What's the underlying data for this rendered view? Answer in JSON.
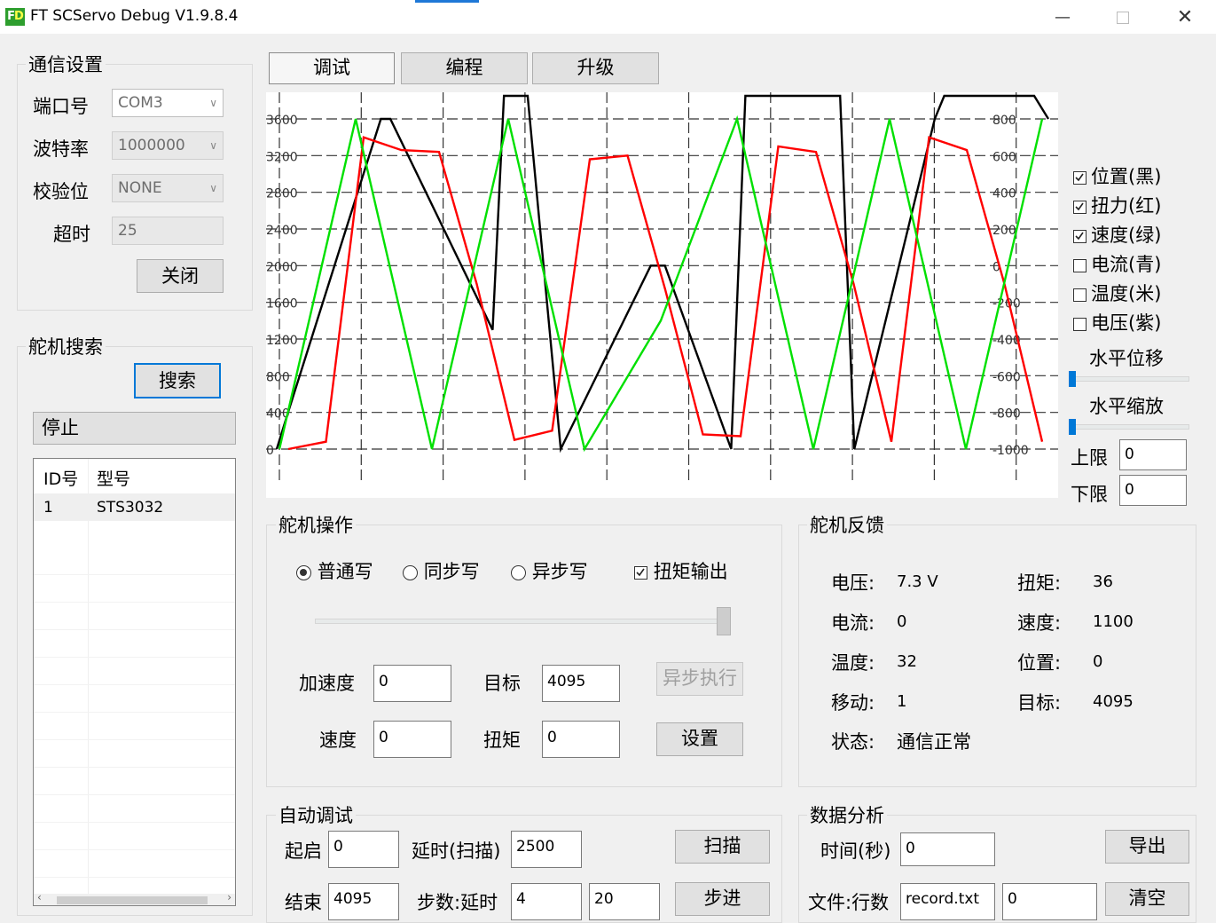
{
  "window": {
    "title": "FT SCServo Debug V1.9.8.4",
    "icon_text": "FD",
    "controls": [
      "minimize-icon",
      "maximize-icon",
      "close-icon"
    ]
  },
  "comm": {
    "group_title": "通信设置",
    "port_label": "端口号",
    "port_value": "COM3",
    "baud_label": "波特率",
    "baud_value": "1000000",
    "parity_label": "校验位",
    "parity_value": "NONE",
    "timeout_label": "超时",
    "timeout_value": "25",
    "close_button": "关闭"
  },
  "search": {
    "group_title": "舵机搜索",
    "search_button": "搜索",
    "stop_button": "停止",
    "columns": [
      "ID号",
      "型号"
    ],
    "rows": [
      {
        "id": "1",
        "model": "STS3032"
      }
    ]
  },
  "tabs": [
    "调试",
    "编程",
    "升级"
  ],
  "chart": {
    "left_ticks": [
      "3600",
      "3200",
      "2800",
      "2400",
      "2000",
      "1600",
      "1200",
      "800",
      "400",
      "0"
    ],
    "right_ticks": [
      "800",
      "600",
      "400",
      "200",
      "0",
      "-200",
      "-400",
      "-600",
      "-800",
      "-1000"
    ],
    "colors": {
      "position": "#000000",
      "torque": "#ff0000",
      "speed": "#00e000"
    }
  },
  "chart_data": {
    "type": "line",
    "left_axis_ylim": [
      0,
      3600
    ],
    "right_axis_ylim": [
      -1000,
      800
    ],
    "grid": true,
    "series": [
      {
        "name": "位置(黑)",
        "axis": "left",
        "x": [
          0,
          12,
          110,
          120,
          228,
          240,
          265,
          300,
          395,
          410,
          480,
          495,
          595,
          610,
          695,
          705,
          800,
          815
        ],
        "values": [
          0,
          400,
          3600,
          3600,
          1300,
          4095,
          4095,
          0,
          2000,
          2000,
          0,
          4095,
          4095,
          0,
          3600,
          4095,
          4095,
          3600
        ]
      },
      {
        "name": "扭力(红)",
        "axis": "right",
        "values": [
          -1000,
          -960,
          700,
          630,
          620,
          -100,
          -950,
          -900,
          580,
          600,
          -130,
          -920,
          -930,
          650,
          620,
          -100,
          -960,
          700,
          630,
          -100,
          -960
        ]
      },
      {
        "name": "速度(绿)",
        "axis": "right",
        "values": [
          -1000,
          800,
          -1000,
          800,
          -1000,
          -300,
          800,
          -1000,
          800,
          -1000,
          800
        ]
      }
    ]
  },
  "legend": {
    "items": [
      {
        "label": "位置(黑)",
        "checked": true
      },
      {
        "label": "扭力(红)",
        "checked": true
      },
      {
        "label": "速度(绿)",
        "checked": true
      },
      {
        "label": "电流(青)",
        "checked": false
      },
      {
        "label": "温度(米)",
        "checked": false
      },
      {
        "label": "电压(紫)",
        "checked": false
      }
    ],
    "h_shift_label": "水平位移",
    "h_scale_label": "水平缩放",
    "upper_label": "上限",
    "upper_value": "0",
    "lower_label": "下限",
    "lower_value": "0"
  },
  "operation": {
    "group_title": "舵机操作",
    "modes": [
      {
        "label": "普通写",
        "selected": true
      },
      {
        "label": "同步写",
        "selected": false
      },
      {
        "label": "异步写",
        "selected": false
      }
    ],
    "torque_output_label": "扭矩输出",
    "torque_output_checked": true,
    "slider_level": 1.0,
    "accel_label": "加速度",
    "accel_value": "0",
    "target_label": "目标",
    "target_value": "4095",
    "async_exec_button": "异步执行",
    "speed_label": "速度",
    "speed_value": "0",
    "torque_label": "扭矩",
    "torque_value": "0",
    "set_button": "设置"
  },
  "feedback": {
    "group_title": "舵机反馈",
    "voltage_label": "电压:",
    "voltage_value": "7.3 V",
    "torque_label": "扭矩:",
    "torque_value": "36",
    "current_label": "电流:",
    "current_value": "0",
    "speed_label": "速度:",
    "speed_value": "1100",
    "temp_label": "温度:",
    "temp_value": "32",
    "position_label": "位置:",
    "position_value": "0",
    "move_label": "移动:",
    "move_value": "1",
    "target_label": "目标:",
    "target_value": "4095",
    "status_label": "状态:",
    "status_value": "通信正常"
  },
  "auto": {
    "group_title": "自动调试",
    "start_label": "起启",
    "start_value": "0",
    "delay_label": "延时(扫描)",
    "delay_value": "2500",
    "scan_button": "扫描",
    "end_label": "结束",
    "end_value": "4095",
    "step_label": "步数:延时",
    "step_value": "4",
    "step_delay_value": "20",
    "step_button": "步进"
  },
  "analysis": {
    "group_title": "数据分析",
    "time_label": "时间(秒)",
    "time_value": "0",
    "export_button": "导出",
    "file_label": "文件:行数",
    "file_value": "record.txt",
    "rows_value": "0",
    "clear_button": "清空"
  }
}
